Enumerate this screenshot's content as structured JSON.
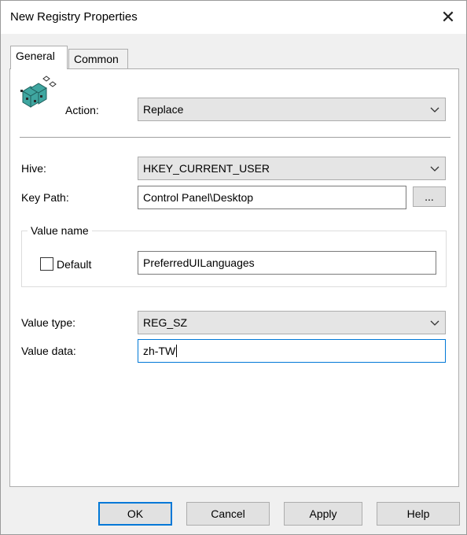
{
  "window": {
    "title": "New Registry Properties",
    "close_glyph": "✕"
  },
  "tabs": [
    {
      "label": "General",
      "active": true
    },
    {
      "label": "Common",
      "active": false
    }
  ],
  "general": {
    "action_label": "Action:",
    "action_value": "Replace",
    "hive_label": "Hive:",
    "hive_value": "HKEY_CURRENT_USER",
    "key_path_label": "Key Path:",
    "key_path_value": "Control Panel\\Desktop",
    "browse_label": "...",
    "value_name_group": "Value name",
    "default_label": "Default",
    "default_checked": false,
    "value_name_value": "PreferredUILanguages",
    "value_type_label": "Value type:",
    "value_type_value": "REG_SZ",
    "value_data_label": "Value data:",
    "value_data_value": "zh-TW"
  },
  "buttons": {
    "ok": "OK",
    "cancel": "Cancel",
    "apply": "Apply",
    "help": "Help"
  },
  "icons": {
    "registry": "registry-cubes-icon",
    "chevron": "chevron-down-icon",
    "close": "close-icon"
  },
  "colors": {
    "accent": "#0078d7",
    "panel": "#ffffff",
    "chrome": "#f0f0f0",
    "cube_teal": "#3fa6a0"
  }
}
